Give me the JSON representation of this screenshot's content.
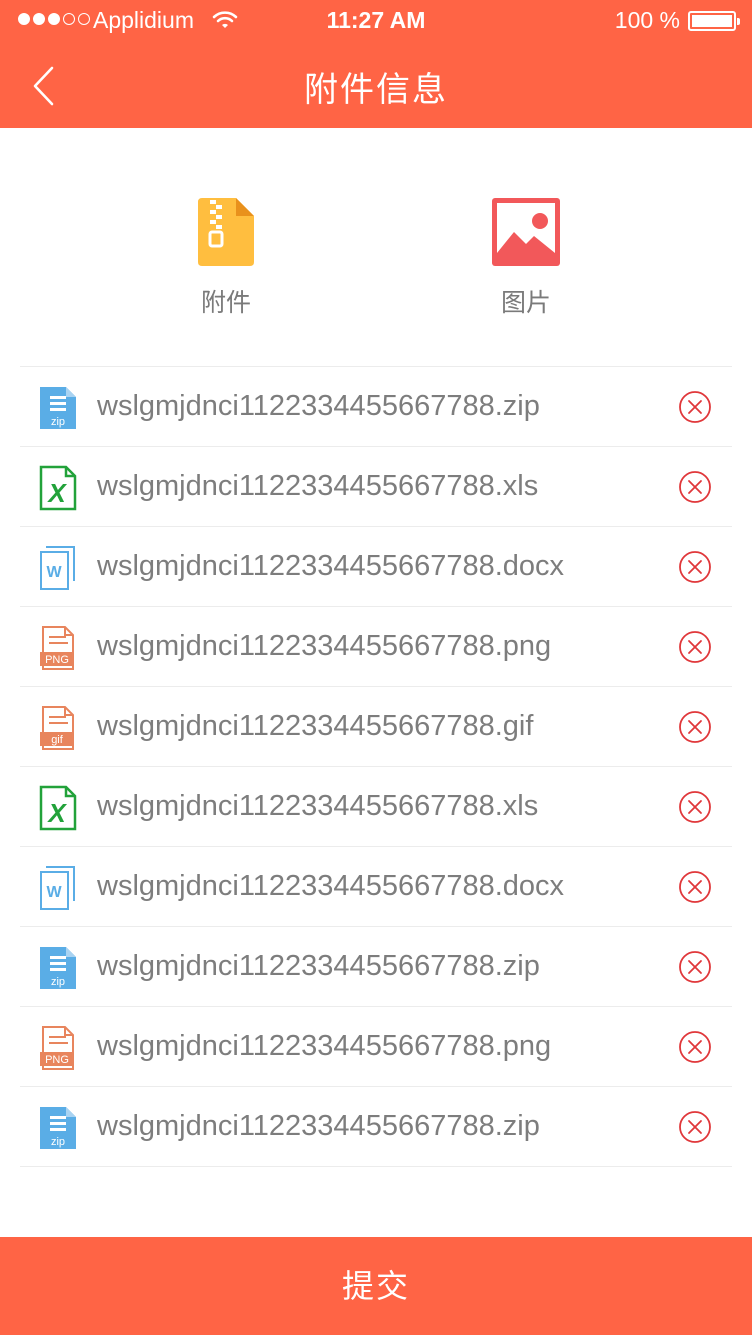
{
  "status_bar": {
    "carrier": "Applidium",
    "time": "11:27 AM",
    "battery": "100 %",
    "signal_bars_filled": 3,
    "signal_bars_total": 5,
    "battery_level": 1.0
  },
  "nav": {
    "title": "附件信息",
    "back_icon": "chevron-left-icon"
  },
  "categories": [
    {
      "label": "附件",
      "icon": "zip-folder-icon",
      "color": "#ffbe3f"
    },
    {
      "label": "图片",
      "icon": "image-icon",
      "color": "#f2585a"
    }
  ],
  "files": [
    {
      "name": "wslgmjdnci1122334455667788.zip",
      "type": "zip"
    },
    {
      "name": "wslgmjdnci1122334455667788.xls",
      "type": "xls"
    },
    {
      "name": "wslgmjdnci1122334455667788.docx",
      "type": "docx"
    },
    {
      "name": "wslgmjdnci1122334455667788.png",
      "type": "png"
    },
    {
      "name": "wslgmjdnci1122334455667788.gif",
      "type": "gif"
    },
    {
      "name": "wslgmjdnci1122334455667788.xls",
      "type": "xls"
    },
    {
      "name": "wslgmjdnci1122334455667788.docx",
      "type": "docx"
    },
    {
      "name": "wslgmjdnci1122334455667788.zip",
      "type": "zip"
    },
    {
      "name": "wslgmjdnci1122334455667788.png",
      "type": "png"
    },
    {
      "name": "wslgmjdnci1122334455667788.zip",
      "type": "zip"
    }
  ],
  "file_type_labels": {
    "zip": "zip",
    "xls": "X",
    "docx": "W",
    "png": "PNG",
    "gif": "gif"
  },
  "file_type_colors": {
    "zip": "#5aade6",
    "xls": "#22a23a",
    "docx": "#5aade6",
    "png": "#e8855d",
    "gif": "#e8855d"
  },
  "delete_icon": "circle-x-icon",
  "submit_label": "提交",
  "colors": {
    "accent": "#ff6445",
    "delete": "#e0373a",
    "text_muted": "#7d7d7d"
  }
}
